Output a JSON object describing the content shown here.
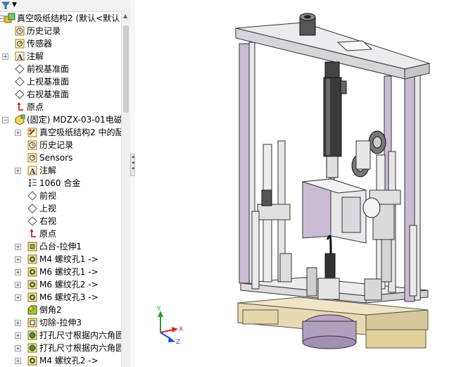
{
  "tree": {
    "root_label": "真空吸纸结构2  (默认<默认",
    "items": [
      {
        "label": "历史记录",
        "icon": "history-icon"
      },
      {
        "label": "传感器",
        "icon": "sensor-icon"
      },
      {
        "label": "注解",
        "icon": "annotation-icon"
      },
      {
        "label": "前视基准面",
        "icon": "plane-icon"
      },
      {
        "label": "上视基准面",
        "icon": "plane-icon"
      },
      {
        "label": "右视基准面",
        "icon": "plane-icon"
      },
      {
        "label": "原点",
        "icon": "origin-icon"
      },
      {
        "label": "(固定) MDZX-03-01电磁",
        "icon": "part-icon"
      },
      {
        "label": "真空吸纸结构2 中的配",
        "icon": "mates-icon"
      },
      {
        "label": "历史记录",
        "icon": "history-icon"
      },
      {
        "label": "Sensors",
        "icon": "sensor-icon"
      },
      {
        "label": "注解",
        "icon": "annotation-icon"
      },
      {
        "label": "1060 合金",
        "icon": "material-icon"
      },
      {
        "label": "前视",
        "icon": "plane-icon"
      },
      {
        "label": "上视",
        "icon": "plane-icon"
      },
      {
        "label": "右视",
        "icon": "plane-icon"
      },
      {
        "label": "原点",
        "icon": "origin-icon"
      },
      {
        "label": "凸台-拉伸1",
        "icon": "extrude-boss-icon"
      },
      {
        "label": "M4 螺纹孔1 ->",
        "icon": "hole-icon"
      },
      {
        "label": "M6 螺纹孔1 ->",
        "icon": "hole-icon"
      },
      {
        "label": "M6 螺纹孔2 ->",
        "icon": "hole-icon"
      },
      {
        "label": "M6 螺纹孔3 ->",
        "icon": "hole-icon"
      },
      {
        "label": "倒角2",
        "icon": "chamfer-icon"
      },
      {
        "label": "切除-拉伸3",
        "icon": "cut-extrude-icon"
      },
      {
        "label": "打孔尺寸根据内六角圆",
        "icon": "hole-wizard-icon"
      },
      {
        "label": "打孔尺寸根据内六角圆",
        "icon": "hole-wizard-icon"
      },
      {
        "label": "M4 螺纹孔2 ->",
        "icon": "hole-icon"
      }
    ]
  },
  "viewport": {
    "triad_axes": [
      "Y",
      "X",
      "Z"
    ]
  },
  "colors": {
    "frame": "#e6e6e8",
    "frame_edge": "#333333",
    "post_purple": "#c9bcd4",
    "base_tan": "#e8d9b0",
    "cylinder_dark": "#3a3a3a",
    "triad_y": "#2ca02c",
    "triad_x": "#d62728",
    "triad_z": "#1f4fd1",
    "tree_selection": "#cce4f7"
  }
}
